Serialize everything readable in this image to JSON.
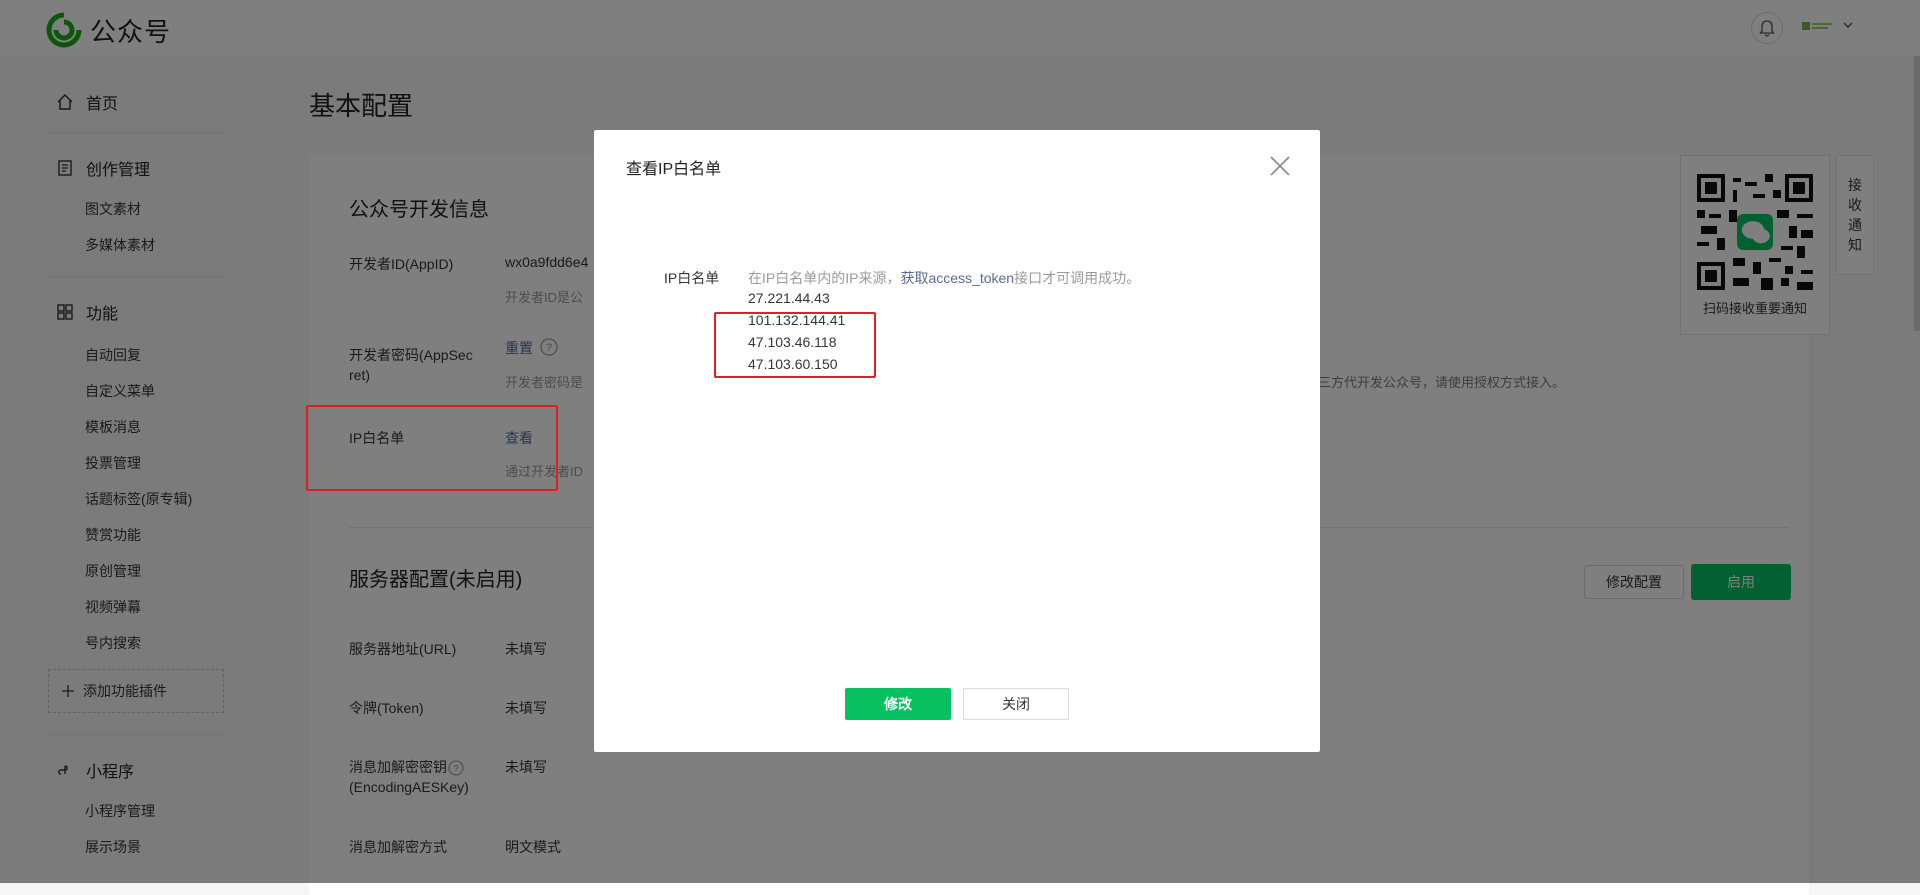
{
  "header": {
    "brand": "公众号",
    "bell_icon": "bell-icon",
    "avatar_icon": "account-avatar-icon",
    "caret": "⌵"
  },
  "sidebar": {
    "home": "首页",
    "creation": "创作管理",
    "creation_items": [
      "图文素材",
      "多媒体素材"
    ],
    "features": "功能",
    "feature_items": [
      "自动回复",
      "自定义菜单",
      "模板消息",
      "投票管理",
      "话题标签(原专辑)",
      "赞赏功能",
      "原创管理",
      "视频弹幕",
      "号内搜索"
    ],
    "add_plugin": "添加功能插件",
    "miniprogram": "小程序",
    "miniprogram_items": [
      "小程序管理",
      "展示场景"
    ]
  },
  "main": {
    "page_title": "基本配置",
    "dev_info_title": "公众号开发信息",
    "appid_label": "开发者ID(AppID)",
    "appid_value": "wx0a9fdd6e4",
    "appid_desc": "开发者ID是公",
    "secret_label_1": "开发者密码(AppSec",
    "secret_label_2": "ret)",
    "secret_reset": "重置",
    "secret_desc": "开发者密码是",
    "secret_desc_right": "三方代开发公众号，请使用授权方式接入。",
    "ip_label": "IP白名单",
    "ip_view": "查看",
    "ip_desc": "通过开发者ID",
    "server_title": "服务器配置(未启用)",
    "btn_modify_config": "修改配置",
    "btn_enable": "启用",
    "server_rows": [
      {
        "label": "服务器地址(URL)",
        "value": "未填写"
      },
      {
        "label": "令牌(Token)",
        "value": "未填写"
      },
      {
        "label": "消息加解密密钥",
        "label2": "(EncodingAESKey)",
        "value": "未填写"
      },
      {
        "label": "消息加解密方式",
        "value": "明文模式"
      }
    ],
    "qr_label": "扫码接收重要通知",
    "notify_tab": [
      "接",
      "收",
      "通",
      "知"
    ]
  },
  "dialog": {
    "title": "查看IP白名单",
    "label": "IP白名单",
    "desc_prefix": "在IP白名单内的IP来源，",
    "desc_link": "获取access_token",
    "desc_suffix": "接口才可调用成功。",
    "ips": [
      "27.221.44.43",
      "101.132.144.41",
      "47.103.46.118",
      "47.103.60.150"
    ],
    "btn_modify": "修改",
    "btn_close": "关闭"
  },
  "colors": {
    "brand_green": "#07c160",
    "link_blue": "#576b95",
    "highlight_red": "#e02020"
  }
}
